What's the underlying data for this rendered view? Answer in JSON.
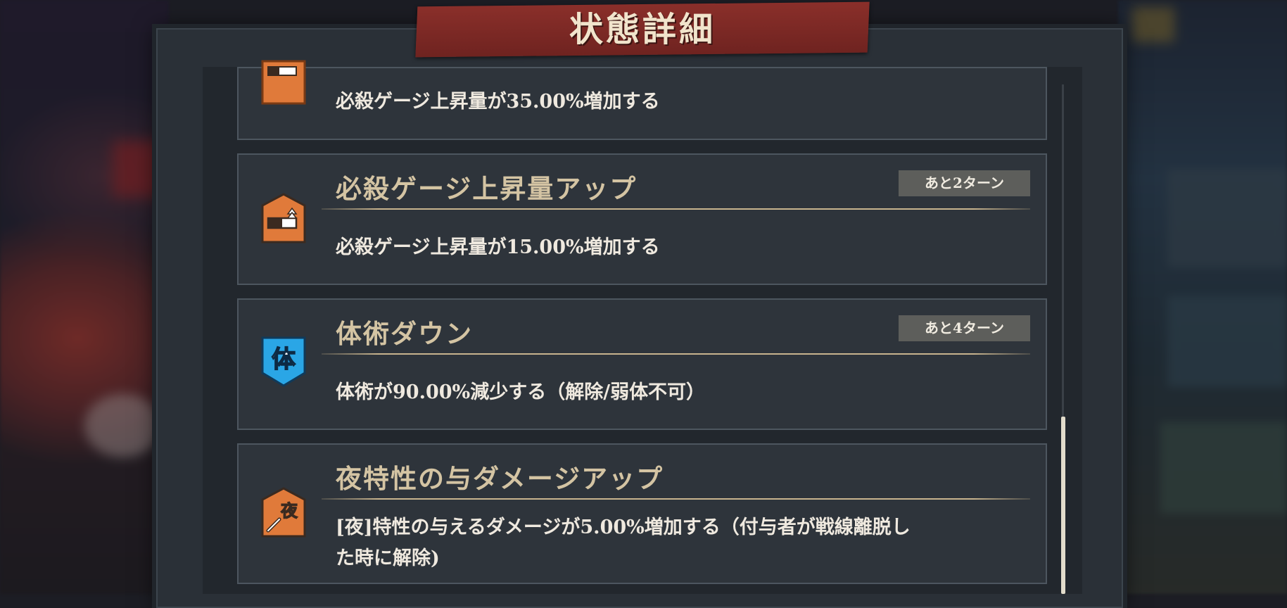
{
  "dialog": {
    "title": "状態詳細"
  },
  "effects": [
    {
      "name": "",
      "turns": "",
      "description": "必殺ゲージ上昇量が35.00%増加する",
      "icon": "gauge-up-icon",
      "icon_color": "#e07a3a"
    },
    {
      "name": "必殺ゲージ上昇量アップ",
      "turns": "あと2ターン",
      "description": "必殺ゲージ上昇量が15.00%増加する",
      "icon": "gauge-up-icon",
      "icon_color": "#e07a3a"
    },
    {
      "name": "体術ダウン",
      "turns": "あと4ターン",
      "description": "体術が90.00%減少する（解除/弱体不可）",
      "icon": "taijutsu-down-icon",
      "icon_color": "#2aa6e6",
      "icon_glyph": "体"
    },
    {
      "name": "夜特性の与ダメージアップ",
      "turns": "",
      "description_line1": "[夜]特性の与えるダメージが5.00%増加する（付与者が戦線離脱し",
      "description_line2": "た時に解除)",
      "icon": "night-damage-up-icon",
      "icon_color": "#e07a3a",
      "icon_glyph": "夜"
    }
  ],
  "colors": {
    "title_banner": "#7d2a26",
    "card_background": "#2e343b",
    "name_text": "#d4c4a3",
    "turn_badge": "#5d5e5b"
  }
}
